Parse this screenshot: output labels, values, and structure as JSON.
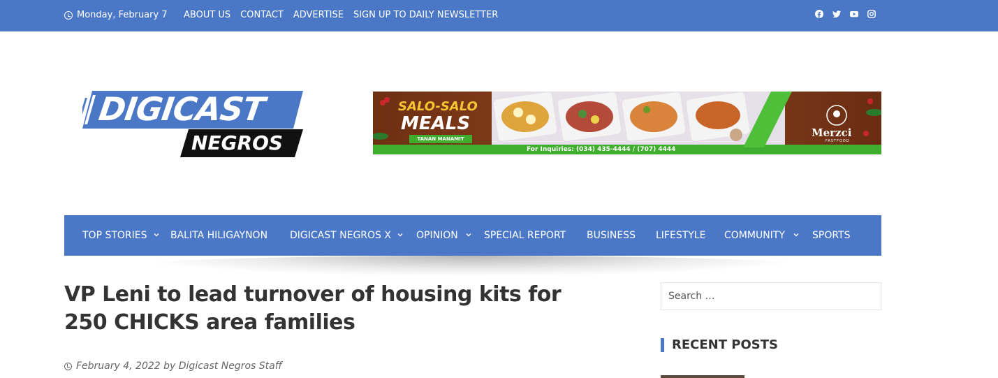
{
  "topbar": {
    "date": "Monday, February 7",
    "links": [
      "ABOUT US",
      "CONTACT",
      "ADVERTISE",
      "SIGN UP TO DAILY NEWSLETTER"
    ],
    "social_icons": [
      "facebook-icon",
      "twitter-icon",
      "youtube-icon",
      "instagram-icon"
    ],
    "background": "#4a77c6"
  },
  "logo": {
    "line1": "DIGICAST",
    "line2": "NEGROS"
  },
  "ad": {
    "headline1": "SALO-SALO",
    "headline2": "MEALS",
    "tagline": "TANAN MANAMIT",
    "inquiries": "For Inquiries: (034) 435-4444 / (707) 4444",
    "brand": "Merzci",
    "brand_sub": "FASTFOOD"
  },
  "nav": {
    "items": [
      {
        "label": "TOP STORIES",
        "has_dropdown": true
      },
      {
        "label": "BALITA HILIGAYNON",
        "has_dropdown": false
      },
      {
        "label": "DIGICAST NEGROS X",
        "has_dropdown": true
      },
      {
        "label": "OPINION",
        "has_dropdown": true
      },
      {
        "label": "SPECIAL REPORT",
        "has_dropdown": false
      },
      {
        "label": "BUSINESS",
        "has_dropdown": false
      },
      {
        "label": "LIFESTYLE",
        "has_dropdown": false
      },
      {
        "label": "COMMUNITY",
        "has_dropdown": true
      },
      {
        "label": "SPORTS",
        "has_dropdown": false
      }
    ]
  },
  "article": {
    "title": "VP Leni to lead turnover of housing kits for 250 CHICKS area families",
    "meta": "February 4, 2022 by Digicast Negros Staff"
  },
  "sidebar": {
    "search_placeholder": "Search …",
    "recent_posts_title": "RECENT POSTS"
  }
}
